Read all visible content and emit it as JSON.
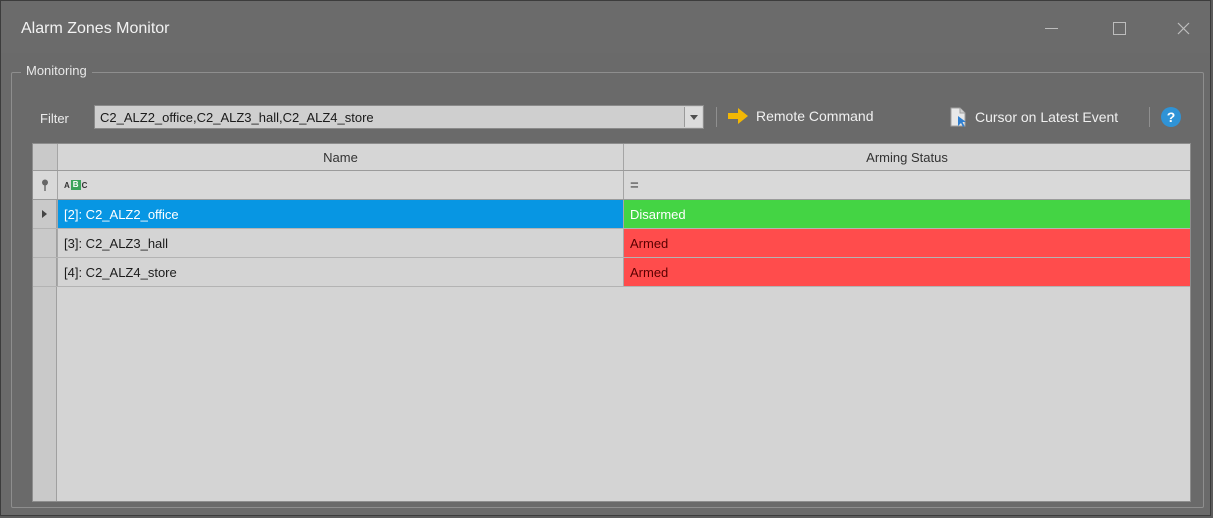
{
  "window": {
    "title": "Alarm Zones Monitor",
    "controls": [
      "minimize-icon",
      "maximize-icon",
      "close-icon"
    ]
  },
  "group": {
    "label": "Monitoring"
  },
  "toolbar": {
    "filter_label": "Filter",
    "filter_value": "C2_ALZ2_office,C2_ALZ3_hall,C2_ALZ4_store",
    "remote_command_label": "Remote Command",
    "cursor_label": "Cursor on Latest Event",
    "help_glyph": "?"
  },
  "grid": {
    "columns": [
      "Name",
      "Arming Status"
    ],
    "filter_row": {
      "name_icon": "abc-filter-icon",
      "status_operator": "="
    },
    "rows": [
      {
        "name": "[2]: C2_ALZ2_office",
        "status": "Disarmed",
        "selected": true,
        "status_color": "#44d444"
      },
      {
        "name": "[3]: C2_ALZ3_hall",
        "status": "Armed",
        "selected": false,
        "status_color": "#ff4c4c"
      },
      {
        "name": "[4]: C2_ALZ4_store",
        "status": "Armed",
        "selected": false,
        "status_color": "#ff4c4c"
      }
    ]
  },
  "colors": {
    "selection": "#0796e3",
    "armed": "#ff4c4c",
    "disarmed": "#44d444",
    "accent_arrow": "#f2b705",
    "help": "#2f93d6"
  }
}
